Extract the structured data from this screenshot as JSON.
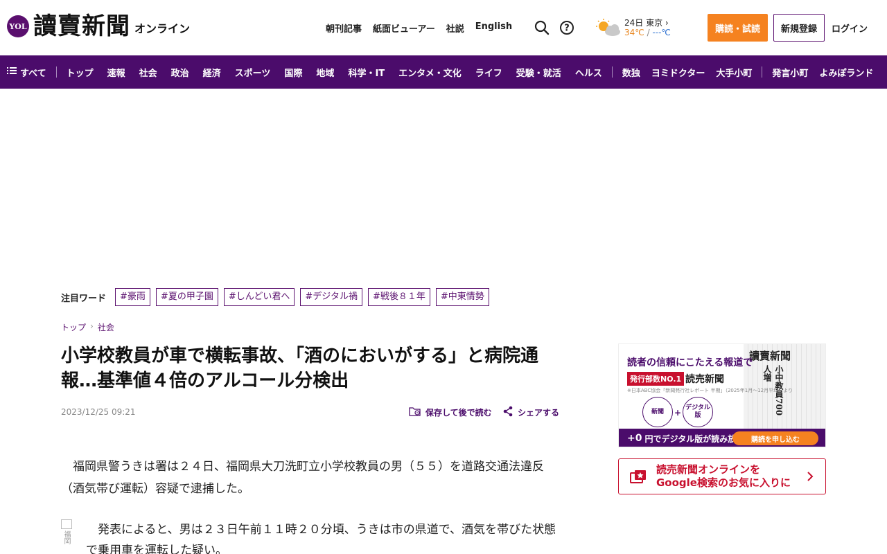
{
  "header": {
    "logo_badge": "YOL",
    "logo_title": "讀賣新聞",
    "logo_sub": "オンライン",
    "links": [
      "朝刊記事",
      "紙面ビューアー",
      "社説",
      "English"
    ],
    "search_icon": "search-icon",
    "help_icon": "question-circle-icon",
    "weather": {
      "icon": "sun-cloud-icon",
      "date_city": "24日 東京",
      "temp_high": "34℃",
      "sep": " / ",
      "temp_low": "---℃"
    },
    "subscribe_label": "購読・試読",
    "register_label": "新規登録",
    "login_label": "ログイン"
  },
  "nav": {
    "all_label": "すべて",
    "group1": [
      "トップ",
      "速報",
      "社会",
      "政治",
      "経済",
      "スポーツ",
      "国際",
      "地域",
      "科学・IT",
      "エンタメ・文化",
      "ライフ",
      "受験・就活",
      "ヘルス"
    ],
    "group2": [
      "数独",
      "ヨミドクター",
      "大手小町"
    ],
    "group3": [
      "発言小町",
      "よみぽランド"
    ]
  },
  "trend": {
    "label": "注目ワード",
    "tags": [
      "#豪雨",
      "#夏の甲子園",
      "#しんどい君へ",
      "#デジタル禍",
      "#戦後８１年",
      "#中東情勢"
    ]
  },
  "breadcrumb": {
    "items": [
      "トップ",
      "社会"
    ],
    "sep": "›"
  },
  "article": {
    "headline": "小学校教員が車で横転事故、「酒のにおいがする」と病院通報…基準値４倍のアルコール分検出",
    "date": "2023/12/25 09:21",
    "save_label": "保存して後で読む",
    "share_label": "シェアする",
    "para1": "福岡県警うきは署は２４日、福岡県大刀洗町立小学校教員の男（５５）を道路交通法違反（酒気帯び運転）容疑で逮捕した。",
    "photo_alt": "福岡",
    "para2": "発表によると、男は２３日午前１１時２０分頃、うきは市の県道で、酒気を帯びた状態で乗用車を運転した疑い。"
  },
  "sidebar": {
    "ad": {
      "headline": "読者の信頼にこたえる報道で",
      "badge": "発行部数NO.1",
      "name": "読売新聞",
      "fine_print": "※日本ABC協会「新聞発行社レポート 半期」（2025年1月～12月平均）より",
      "circle1": "新聞",
      "plus": "+",
      "circle2": "デジタル版",
      "paper_title": "讀賣新聞",
      "paper_headline": "小中教員700人増",
      "bar_plus": "+0",
      "bar_text": "円でデジタル版が読み放題！",
      "cta": "購読を申し込む"
    },
    "google": {
      "line1": "読売新聞オンラインを",
      "line2": "Google検索のお気に入りに",
      "icon": "star-bookmark-icon",
      "arrow": "chevron-right-icon"
    }
  },
  "colors": {
    "brand_purple": "#4b0c6b",
    "accent_orange": "#f58220",
    "accent_red": "#c8102e"
  }
}
